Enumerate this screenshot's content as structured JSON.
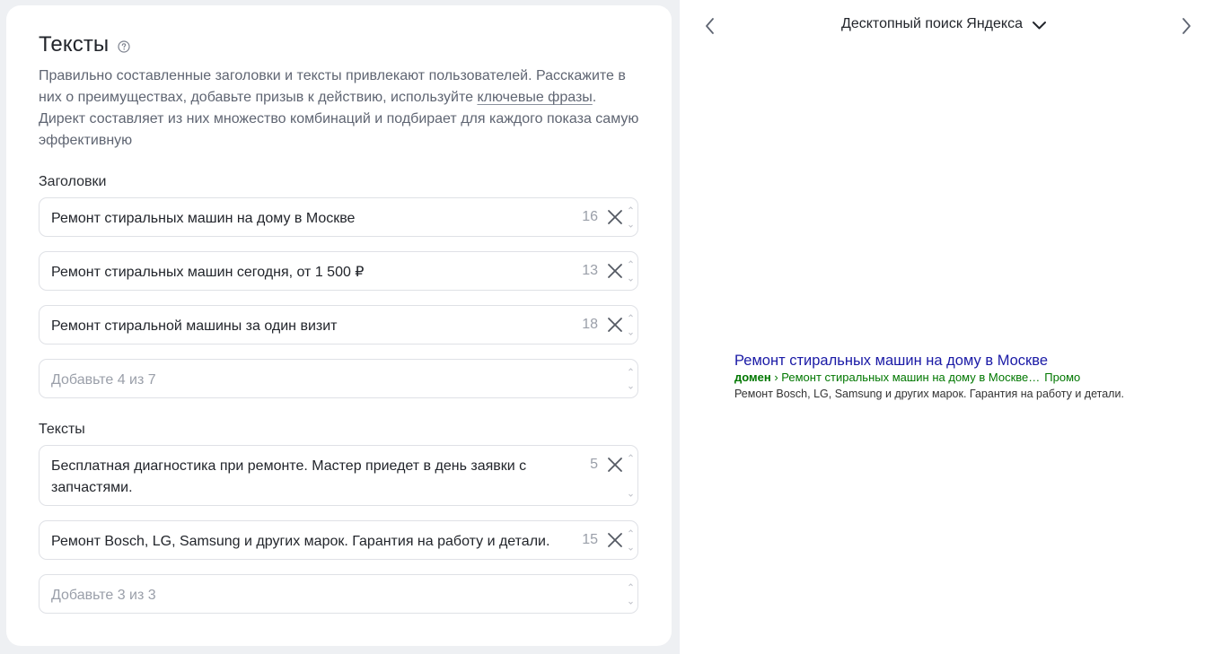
{
  "editor": {
    "title": "Тексты",
    "description_before": "Правильно составленные заголовки и тексты привлекают пользователей. Расскажите в них о преимуществах, добавьте призыв к действию, используйте ",
    "description_link": "ключевые фразы",
    "description_after": ". Директ составляет из них множество комбинаций и подбирает для каждого показа самую эффективную",
    "headlines_label": "Заголовки",
    "headlines": [
      {
        "value": "Ремонт стиральных машин на дому в Москве",
        "count": "16"
      },
      {
        "value": "Ремонт стиральных машин сегодня, от 1 500 ₽",
        "count": "13"
      },
      {
        "value": "Ремонт стиральной машины за один визит",
        "count": "18"
      }
    ],
    "headline_placeholder": "Добавьте 4 из 7",
    "texts_label": "Тексты",
    "texts": [
      {
        "value": "Бесплатная диагностика при ремонте. Мастер приедет в день заявки с запчастями.",
        "count": "5"
      },
      {
        "value": "Ремонт Bosch, LG, Samsung и других марок. Гарантия на работу и детали.",
        "count": "15"
      }
    ],
    "text_placeholder": "Добавьте 3 из 3"
  },
  "preview": {
    "mode": "Десктопный поиск Яндекса",
    "ad": {
      "title": "Ремонт стиральных машин на дому в Москве",
      "domain": "домен",
      "path": " › Ремонт стиральных машин на дому в Москве…",
      "promo": "Промо",
      "text": "Ремонт Bosch, LG, Samsung и других марок. Гарантия на работу и детали."
    }
  },
  "colors": {
    "background": "#eef0f3",
    "ad_title": "#1a1aa6",
    "ad_url": "#007700"
  }
}
